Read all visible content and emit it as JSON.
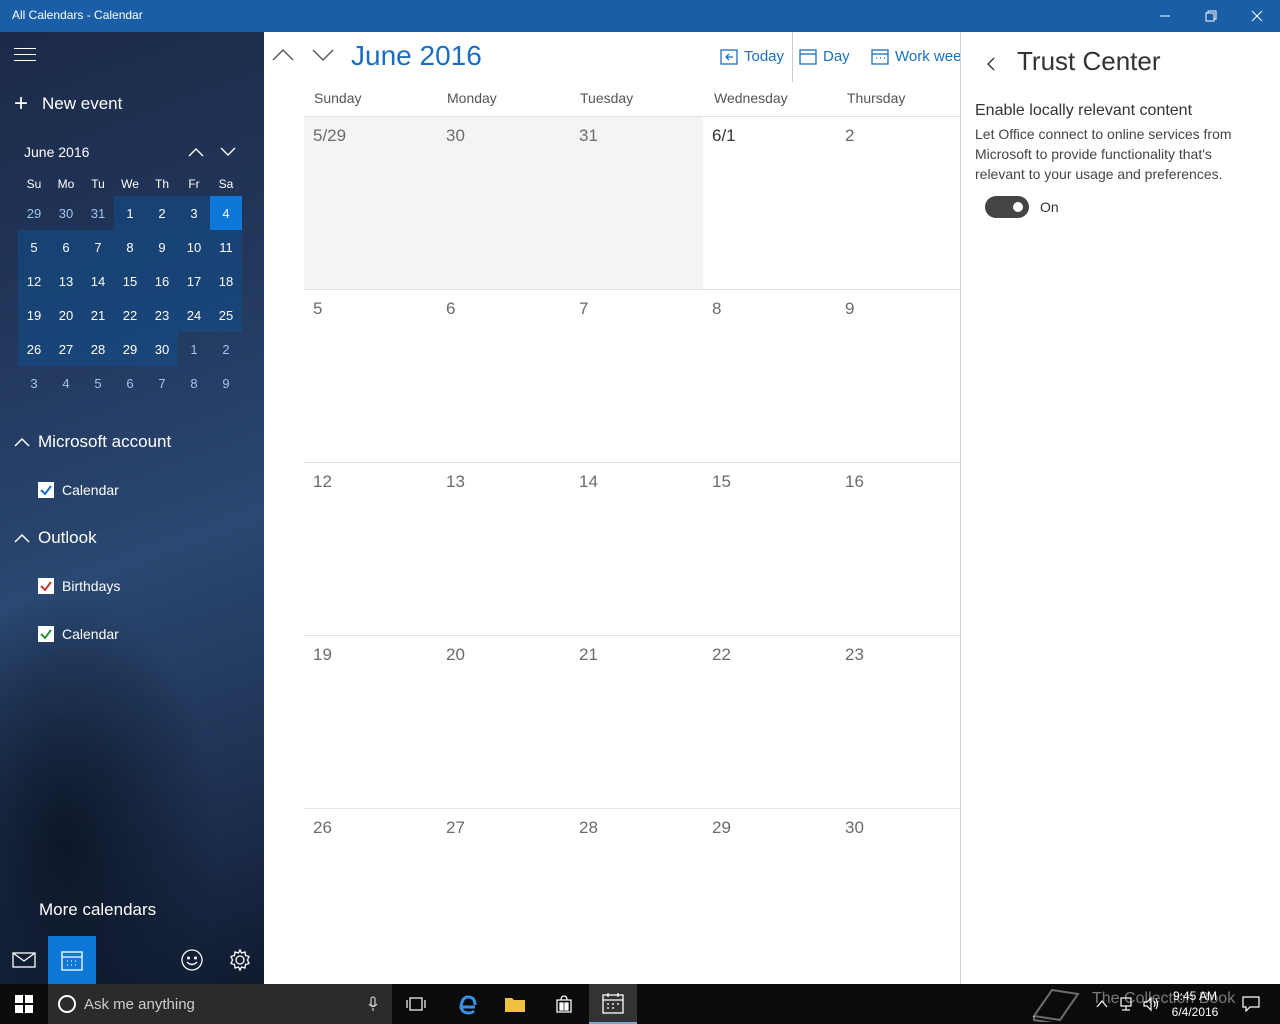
{
  "window": {
    "title": "All Calendars - Calendar"
  },
  "sidebar": {
    "new_event": "New event",
    "mini_calendar": {
      "month_label": "June 2016",
      "dow": [
        "Su",
        "Mo",
        "Tu",
        "We",
        "Th",
        "Fr",
        "Sa"
      ],
      "weeks": [
        [
          "29",
          "30",
          "31",
          "1",
          "2",
          "3",
          "4"
        ],
        [
          "5",
          "6",
          "7",
          "8",
          "9",
          "10",
          "11"
        ],
        [
          "12",
          "13",
          "14",
          "15",
          "16",
          "17",
          "18"
        ],
        [
          "19",
          "20",
          "21",
          "22",
          "23",
          "24",
          "25"
        ],
        [
          "26",
          "27",
          "28",
          "29",
          "30",
          "1",
          "2"
        ],
        [
          "3",
          "4",
          "5",
          "6",
          "7",
          "8",
          "9"
        ]
      ],
      "selected_day": "4"
    },
    "accounts": [
      {
        "name": "Microsoft account",
        "calendars": [
          {
            "label": "Calendar",
            "checked": true,
            "color": "#1a6fc2"
          }
        ]
      },
      {
        "name": "Outlook",
        "calendars": [
          {
            "label": "Birthdays",
            "checked": true,
            "color": "#c0392b"
          },
          {
            "label": "Calendar",
            "checked": true,
            "color": "#2e8b3a"
          }
        ]
      }
    ],
    "more_calendars": "More calendars"
  },
  "main": {
    "month_title": "June 2016",
    "views": {
      "today": "Today",
      "day": "Day",
      "work_week": "Work week"
    },
    "day_headers": [
      "Sunday",
      "Monday",
      "Tuesday",
      "Wednesday",
      "Thursday"
    ],
    "weeks": [
      [
        "5/29",
        "30",
        "31",
        "6/1",
        "2"
      ],
      [
        "5",
        "6",
        "7",
        "8",
        "9"
      ],
      [
        "12",
        "13",
        "14",
        "15",
        "16"
      ],
      [
        "19",
        "20",
        "21",
        "22",
        "23"
      ],
      [
        "26",
        "27",
        "28",
        "29",
        "30"
      ]
    ]
  },
  "trust_center": {
    "title": "Trust Center",
    "heading": "Enable locally relevant content",
    "description": "Let Office connect to online services from Microsoft to provide functionality that's relevant to your usage and preferences.",
    "toggle_label": "On",
    "toggle_on": true
  },
  "taskbar": {
    "search_placeholder": "Ask me anything",
    "watermark": "The Collection Book",
    "time": "9:45 AM",
    "date": "6/4/2016"
  },
  "colors": {
    "accent": "#1a6fc2",
    "titlebar": "#1a5ea8",
    "today_highlight": "#0e78d8"
  }
}
